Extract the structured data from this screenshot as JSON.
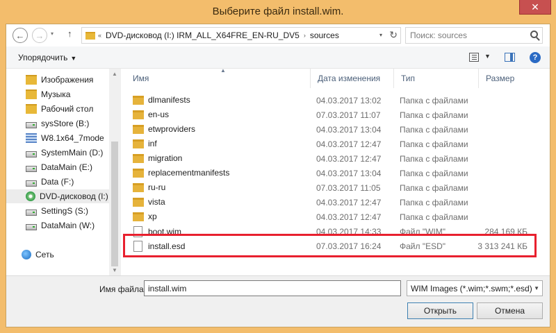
{
  "window": {
    "title": "Выберите файл install.wim.",
    "close_glyph": "✕"
  },
  "address": {
    "prefix": "«",
    "crumbs": [
      "DVD-дисковод (I:) IRM_ALL_X64FRE_EN-RU_DV5",
      "sources"
    ],
    "separator": "›",
    "refresh_glyph": "↻",
    "search_placeholder": "Поиск: sources"
  },
  "nav_buttons": {
    "back": "←",
    "forward": "→",
    "up": "↑",
    "dropdown": "▾"
  },
  "toolbar": {
    "organize_label": "Упорядочить",
    "organize_caret": "▼",
    "view_caret": "▼",
    "help": "?"
  },
  "nav_pane": {
    "items": [
      {
        "label": "Изображения",
        "icon": "folder-icon"
      },
      {
        "label": "Музыка",
        "icon": "folder-icon"
      },
      {
        "label": "Рабочий стол",
        "icon": "folder-icon"
      },
      {
        "label": "sysStore (B:)",
        "icon": "drive-icon"
      },
      {
        "label": "W8.1x64_7mode",
        "icon": "server-icon"
      },
      {
        "label": "SystemMain (D:)",
        "icon": "drive-icon"
      },
      {
        "label": "DataMain (E:)",
        "icon": "drive-icon"
      },
      {
        "label": "Data (F:)",
        "icon": "drive-icon"
      },
      {
        "label": "DVD-дисковод (I:)",
        "icon": "dvd-icon",
        "selected": true
      },
      {
        "label": "SettingS (S:)",
        "icon": "drive-icon"
      },
      {
        "label": "DataMain (W:)",
        "icon": "drive-icon"
      },
      {
        "label": "Сеть",
        "icon": "network-icon"
      }
    ]
  },
  "file_list": {
    "columns": {
      "name": "Имя",
      "date": "Дата изменения",
      "type": "Тип",
      "size": "Размер"
    },
    "rows": [
      {
        "name": "dlmanifests",
        "date": "04.03.2017 13:02",
        "type": "Папка с файлами",
        "size": "",
        "kind": "folder"
      },
      {
        "name": "en-us",
        "date": "07.03.2017 11:07",
        "type": "Папка с файлами",
        "size": "",
        "kind": "folder"
      },
      {
        "name": "etwproviders",
        "date": "04.03.2017 13:04",
        "type": "Папка с файлами",
        "size": "",
        "kind": "folder"
      },
      {
        "name": "inf",
        "date": "04.03.2017 12:47",
        "type": "Папка с файлами",
        "size": "",
        "kind": "folder"
      },
      {
        "name": "migration",
        "date": "04.03.2017 12:47",
        "type": "Папка с файлами",
        "size": "",
        "kind": "folder"
      },
      {
        "name": "replacementmanifests",
        "date": "04.03.2017 13:04",
        "type": "Папка с файлами",
        "size": "",
        "kind": "folder"
      },
      {
        "name": "ru-ru",
        "date": "07.03.2017 11:05",
        "type": "Папка с файлами",
        "size": "",
        "kind": "folder"
      },
      {
        "name": "vista",
        "date": "04.03.2017 12:47",
        "type": "Папка с файлами",
        "size": "",
        "kind": "folder"
      },
      {
        "name": "xp",
        "date": "04.03.2017 12:47",
        "type": "Папка с файлами",
        "size": "",
        "kind": "folder"
      },
      {
        "name": "boot.wim",
        "date": "04.03.2017 14:33",
        "type": "Файл \"WIM\"",
        "size": "284 169 КБ",
        "kind": "file"
      },
      {
        "name": "install.esd",
        "date": "07.03.2017 16:24",
        "type": "Файл \"ESD\"",
        "size": "3 313 241 КБ",
        "kind": "file"
      }
    ]
  },
  "bottom": {
    "filename_label": "Имя файла:",
    "filename_value": "install.wim",
    "filter_value": "WIM Images (*.wim;*.swm;*.esd)",
    "filter_caret": "▼",
    "open_label": "Открыть",
    "cancel_label": "Отмена"
  },
  "colors": {
    "frame": "#f3bd6c",
    "close": "#c75050",
    "highlight": "#e8202e"
  }
}
